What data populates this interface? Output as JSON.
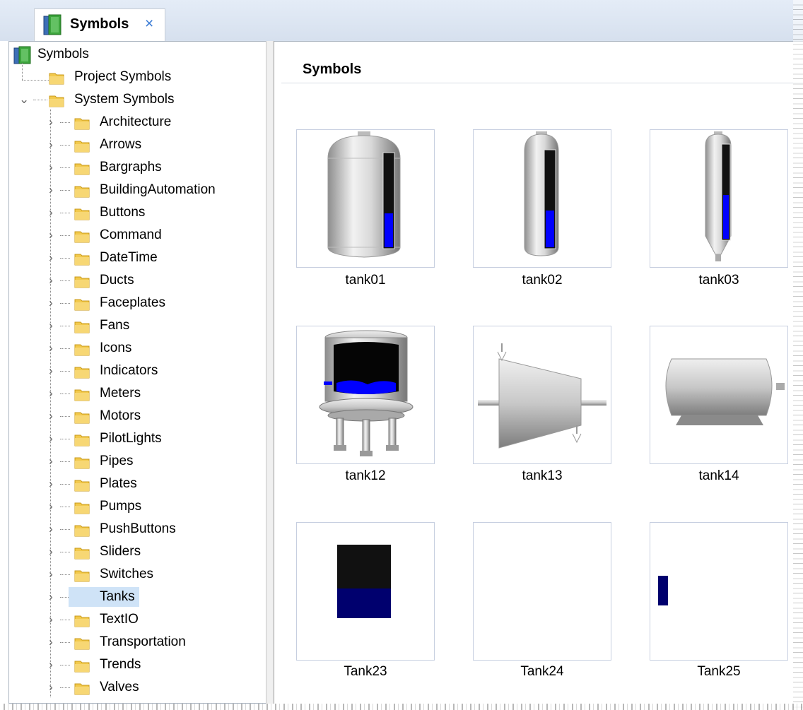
{
  "tab": {
    "title": "Symbols",
    "close": "×"
  },
  "tree": {
    "root": "Symbols",
    "project": "Project Symbols",
    "system": "System Symbols",
    "folders": [
      "Architecture",
      "Arrows",
      "Bargraphs",
      "BuildingAutomation",
      "Buttons",
      "Command",
      "DateTime",
      "Ducts",
      "Faceplates",
      "Fans",
      "Icons",
      "Indicators",
      "Meters",
      "Motors",
      "PilotLights",
      "Pipes",
      "Plates",
      "Pumps",
      "PushButtons",
      "Sliders",
      "Switches",
      "Tanks",
      "TextIO",
      "Transportation",
      "Trends",
      "Valves"
    ],
    "selected": "Tanks"
  },
  "content": {
    "title": "Symbols",
    "tiles": [
      "tank01",
      "tank02",
      "tank03",
      "tank12",
      "tank13",
      "tank14",
      "Tank23",
      "Tank24",
      "Tank25"
    ]
  },
  "colors": {
    "accent_blue": "#0000ff",
    "navy": "#00006e",
    "selection": "#cfe3f7"
  }
}
